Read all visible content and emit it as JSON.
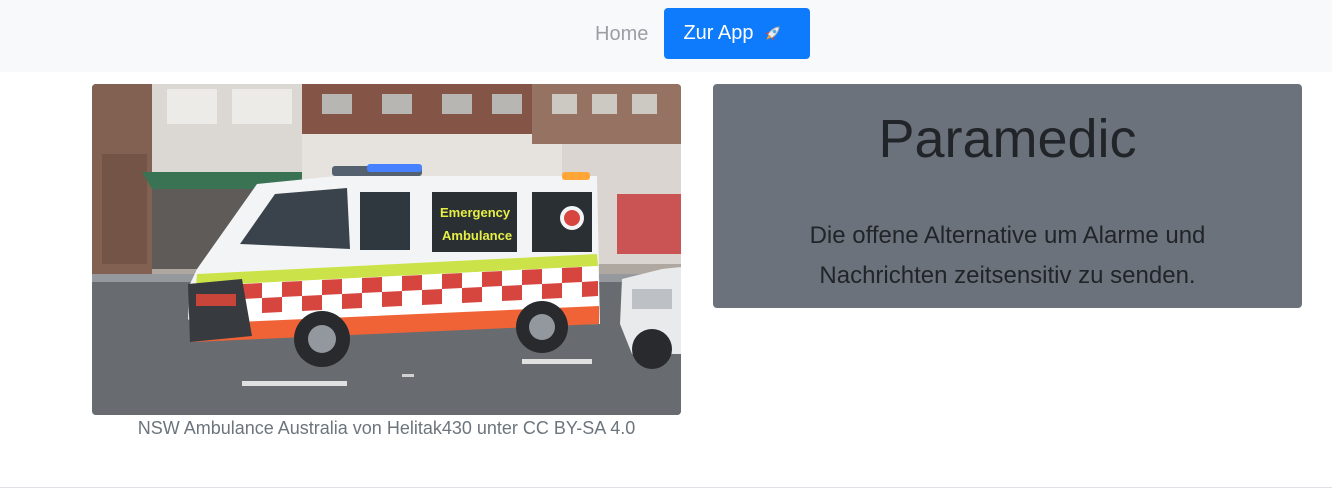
{
  "nav": {
    "home_label": "Home",
    "app_label": "Zur App",
    "app_icon": "rocket-icon",
    "app_color": "#0d7bfb"
  },
  "figure": {
    "vehicle_text_line1": "Emergency",
    "vehicle_text_line2": "Ambulance",
    "caption": "NSW Ambulance Australia von Helitak430 unter CC BY-SA 4.0"
  },
  "hero": {
    "title": "Paramedic",
    "text": "Die offene Alternative um Alarme und Nachrichten zeitsensitiv zu senden.",
    "background": "#6c727b"
  }
}
